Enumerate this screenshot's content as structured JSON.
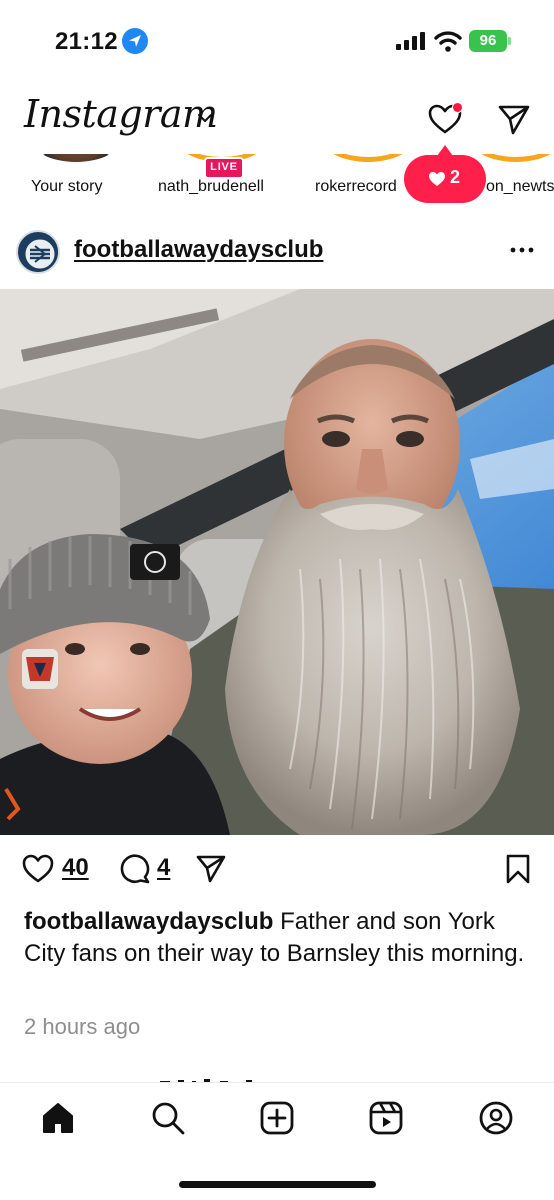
{
  "status_bar": {
    "time": "21:12",
    "battery": "96",
    "icons": [
      "location-icon",
      "signal-icon",
      "wifi-icon",
      "battery-icon"
    ]
  },
  "header": {
    "logo": "Instagram",
    "icons": [
      "chevron-down-icon",
      "heart-icon",
      "send-icon"
    ]
  },
  "stories": [
    {
      "label": "Your story"
    },
    {
      "label": "nath_brudenell",
      "live_badge": "LIVE"
    },
    {
      "label": "rokerrecord"
    },
    {
      "label": "on_newts"
    }
  ],
  "notification": {
    "count": "2",
    "color": "#ff1f4b"
  },
  "post": {
    "username": "footballawaydaysclub",
    "avatar_text_top": "AWAY DAYS",
    "avatar_text_bottom": "CLUB",
    "likes": "40",
    "comments": "4",
    "caption_user": "footballawaydaysclub",
    "caption_text": "Father and son York City fans on their way to Barnsley this morning.",
    "timestamp": "2 hours ago"
  },
  "bottom_nav": {
    "items": [
      "home-icon",
      "search-icon",
      "create-icon",
      "reels-icon",
      "profile-icon"
    ],
    "active": "home-icon"
  },
  "colors": {
    "live": "#e8175d",
    "battery": "#3ac24e",
    "location": "#1e88f5",
    "muted": "#8e8e8e"
  }
}
